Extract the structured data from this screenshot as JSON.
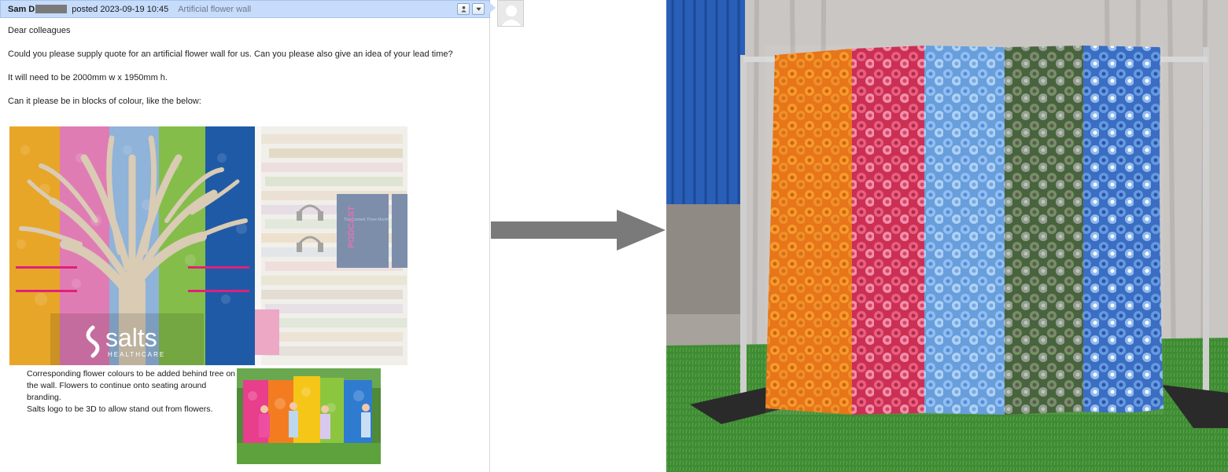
{
  "email": {
    "sender": "Sam D",
    "posted": "posted 2023-09-19 10:45",
    "subject": "Artificial flower wall",
    "lines": [
      "Dear colleagues",
      "Could you please supply quote for an artificial flower wall for us. Can you please also give an idea of your lead time?",
      "It will need to be 2000mm w x 1950mm h.",
      "Can it please be in blocks of colour, like the below:"
    ],
    "image": {
      "logo_text": "salts",
      "logo_subtext": "HEALTHCARE",
      "poster_text": "PODCAST",
      "poster_subtext": "The Content Three Months"
    },
    "caption": [
      "Corresponding flower colours to be added behind tree on",
      "the wall. Flowers to continue onto seating around branding.",
      "Salts logo to be 3D to allow stand out from flowers."
    ]
  },
  "header_buttons": [
    {
      "icon": "person-icon"
    },
    {
      "icon": "chevron-down-icon"
    }
  ],
  "colors": {
    "header_bg": "#c6dcfa",
    "stripe_yellow": "#e8a628",
    "stripe_pink": "#e07cb4",
    "stripe_blue": "#8fb3d9",
    "stripe_green": "#85bd4a",
    "stripe_navy": "#1f5aa6",
    "wall_orange": "#f08a1c",
    "wall_red": "#d9365a",
    "wall_lightblue": "#7fb2e8",
    "wall_green": "#5e7a4e",
    "wall_blue": "#4a84d9"
  }
}
